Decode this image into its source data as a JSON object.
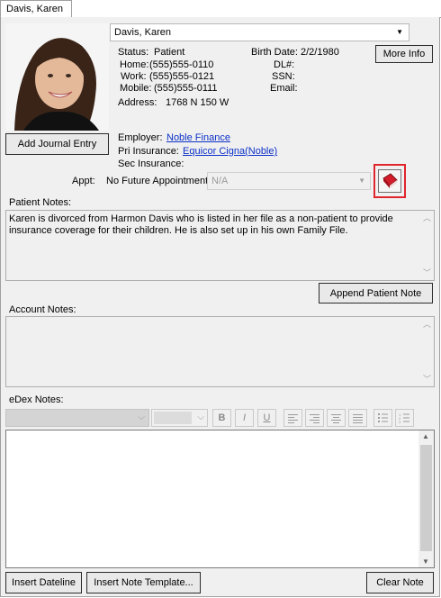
{
  "tab": {
    "label": "Davis, Karen"
  },
  "patient": {
    "name_selected": "Davis, Karen",
    "status_label": "Status:",
    "status_value": "Patient",
    "home_label": "Home:",
    "home_value": "(555)555-0110",
    "work_label": "Work:",
    "work_value": "(555)555-0121",
    "mobile_label": "Mobile:",
    "mobile_value": "(555)555-0111",
    "address_label": "Address:",
    "address_value": "1768 N  150 W",
    "birth_label": "Birth Date:",
    "birth_value": "2/2/1980",
    "dl_label": "DL#:",
    "ssn_label": "SSN:",
    "email_label": "Email:",
    "more_info_label": "More Info"
  },
  "journal": {
    "add_label": "Add Journal Entry"
  },
  "insurance": {
    "employer_label": "Employer:",
    "employer_value": "Noble Finance",
    "pri_label": "Pri Insurance:",
    "pri_value": "Equicor Cigna(Noble)",
    "sec_label": "Sec Insurance:"
  },
  "appt": {
    "label": "Appt:",
    "status": "No Future Appointment",
    "select_value": "N/A"
  },
  "patient_notes": {
    "label": "Patient Notes:",
    "text": "Karen is divorced from Harmon Davis who is listed in her file as a non-patient to provide insurance coverage for their children.  He is also set up in his own Family File.",
    "append_label": "Append Patient Note"
  },
  "account_notes": {
    "label": "Account Notes:"
  },
  "edex_notes": {
    "label": "eDex Notes:",
    "toolbar": {
      "bold": "B",
      "italic": "I",
      "underline": "U"
    }
  },
  "bottom": {
    "insert_dateline": "Insert Dateline",
    "insert_template": "Insert Note Template...",
    "clear_note": "Clear Note"
  },
  "colors": {
    "link": "#0b30c8",
    "highlight_border": "#e0262d",
    "book_red": "#d21c2a"
  }
}
